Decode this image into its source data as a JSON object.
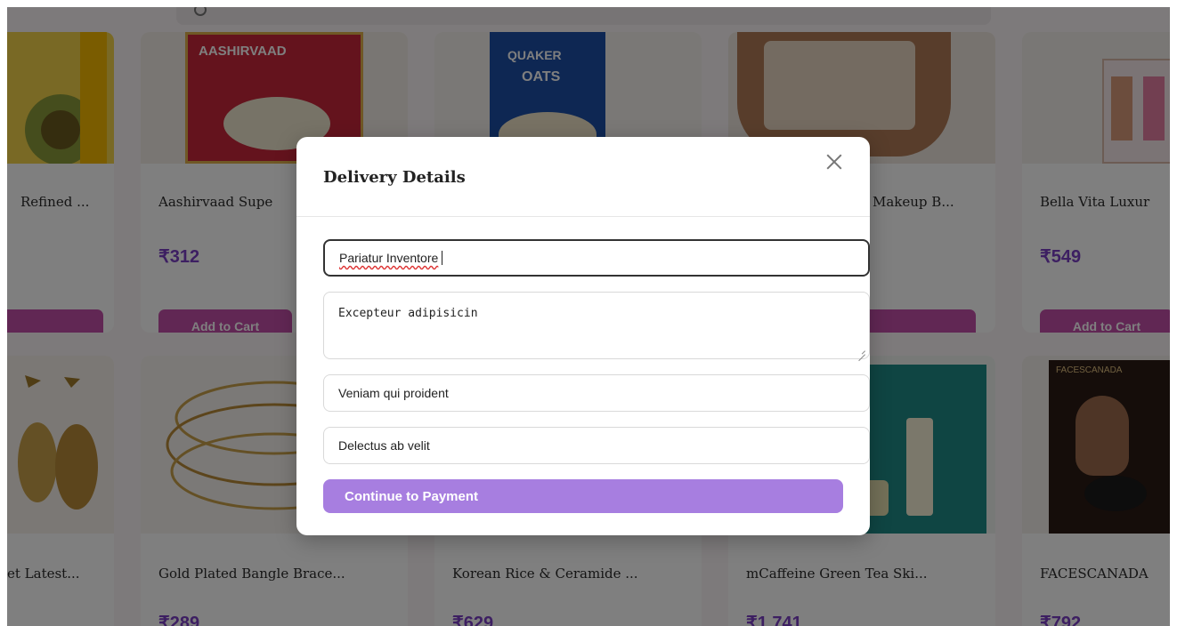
{
  "products_row1": [
    {
      "title": "Refined ...",
      "price": "",
      "cart_label": "",
      "img": "sunflower"
    },
    {
      "title": "Aashirvaad Supe",
      "price": "₹312",
      "cart_label": "Add to Cart",
      "img": "AASHIRVAAD"
    },
    {
      "title": "",
      "price": "",
      "cart_label": "",
      "img": "QUAKER OATS"
    },
    {
      "title": "Makeup B...",
      "price": "",
      "cart_label": "",
      "img": "makeup bag"
    },
    {
      "title": "Bella Vita Luxur",
      "price": "₹549",
      "cart_label": "Add to Cart",
      "img": "perfume"
    }
  ],
  "products_row2": [
    {
      "title": "et Latest...",
      "price": ""
    },
    {
      "title": "Gold Plated Bangle Brace...",
      "price": "₹289"
    },
    {
      "title": "Korean Rice & Ceramide ...",
      "price": "₹629"
    },
    {
      "title": "mCaffeine Green Tea Ski...",
      "price": "₹1,741"
    },
    {
      "title": "FACESCANADA",
      "price": "₹792"
    }
  ],
  "brand_marks": {
    "aashirvaad": "AASHIRVAAD",
    "quaker": "QUAKER",
    "oats": "OATS",
    "faces": "FACESCANADA"
  },
  "modal": {
    "title": "Delivery Details",
    "name_value": "Pariatur Inventore",
    "address_value": "Excepteur adipisicin",
    "phone_value": "Veniam qui proident",
    "pincode_value": "Delectus ab velit",
    "submit_label": "Continue to Payment"
  },
  "colors": {
    "accent": "#7a3fc4",
    "cart_button": "#c24fa8",
    "pay_button": "#a77ee0"
  }
}
